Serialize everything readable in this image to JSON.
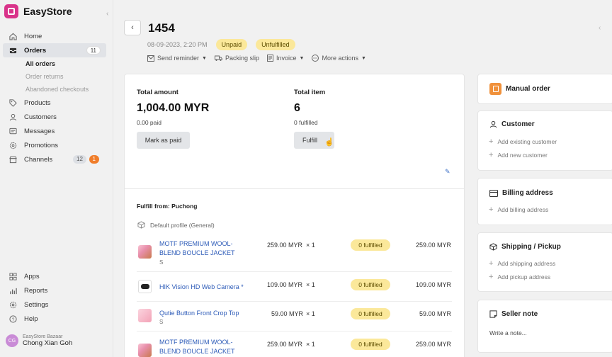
{
  "brand": {
    "name": "EasyStore"
  },
  "sidebar": {
    "items": [
      {
        "label": "Home",
        "icon": "home-icon"
      },
      {
        "label": "Orders",
        "icon": "inbox-icon",
        "badge": "11"
      },
      {
        "label": "Products",
        "icon": "tag-icon"
      },
      {
        "label": "Customers",
        "icon": "user-icon"
      },
      {
        "label": "Messages",
        "icon": "message-icon"
      },
      {
        "label": "Promotions",
        "icon": "gear-icon"
      },
      {
        "label": "Channels",
        "icon": "store-icon",
        "badge1": "12",
        "badge2": "1"
      }
    ],
    "orders_sub": [
      "All orders",
      "Order returns",
      "Abandoned checkouts"
    ],
    "bottom": [
      {
        "label": "Apps",
        "icon": "apps-icon"
      },
      {
        "label": "Reports",
        "icon": "bar-chart-icon"
      },
      {
        "label": "Settings",
        "icon": "gear-icon"
      },
      {
        "label": "Help",
        "icon": "help-icon"
      }
    ],
    "user": {
      "initials": "CG",
      "store": "EasyStore Bazaar",
      "name": "Chong Xian Goh"
    }
  },
  "order": {
    "number": "1454",
    "date": "08-09-2023, 2:20 PM",
    "payment_status": "Unpaid",
    "fulfillment_status": "Unfulfilled",
    "actions": [
      "Send reminder",
      "Packing slip",
      "Invoice",
      "More actions"
    ]
  },
  "summary": {
    "total_amount_label": "Total amount",
    "total_amount": "1,004.00 MYR",
    "paid": "0.00 paid",
    "mark_paid_label": "Mark as paid",
    "total_item_label": "Total item",
    "total_item": "6",
    "fulfilled": "0 fulfilled",
    "fulfill_label": "Fulfill"
  },
  "fulfillment": {
    "from_label": "Fulfill from: Puchong",
    "profile": "Default profile (General)",
    "items": [
      {
        "name": "MOTF PREMIUM WOOL-BLEND BOUCLE JACKET",
        "variant": "S",
        "price": "259.00 MYR",
        "qty": "× 1",
        "status": "0 fulfilled",
        "total": "259.00 MYR",
        "thumb": "jacket"
      },
      {
        "name": "HIK Vision HD Web Camera *",
        "variant": "",
        "price": "109.00 MYR",
        "qty": "× 1",
        "status": "0 fulfilled",
        "total": "109.00 MYR",
        "thumb": "cam"
      },
      {
        "name": "Qutie Button Front Crop Top",
        "variant": "S",
        "price": "59.00 MYR",
        "qty": "× 1",
        "status": "0 fulfilled",
        "total": "59.00 MYR",
        "thumb": "crop"
      },
      {
        "name": "MOTF PREMIUM WOOL-BLEND BOUCLE JACKET",
        "variant": "",
        "price": "259.00 MYR",
        "qty": "× 1",
        "status": "0 fulfilled",
        "total": "259.00 MYR",
        "thumb": "jacket"
      }
    ]
  },
  "side": {
    "manual_order": "Manual order",
    "customer_title": "Customer",
    "add_existing_customer": "Add existing customer",
    "add_new_customer": "Add new customer",
    "billing_title": "Billing address",
    "add_billing": "Add billing address",
    "shipping_title": "Shipping / Pickup",
    "add_shipping": "Add shipping address",
    "add_pickup": "Add pickup address",
    "seller_note_title": "Seller note",
    "note_placeholder": "Write a note..."
  }
}
